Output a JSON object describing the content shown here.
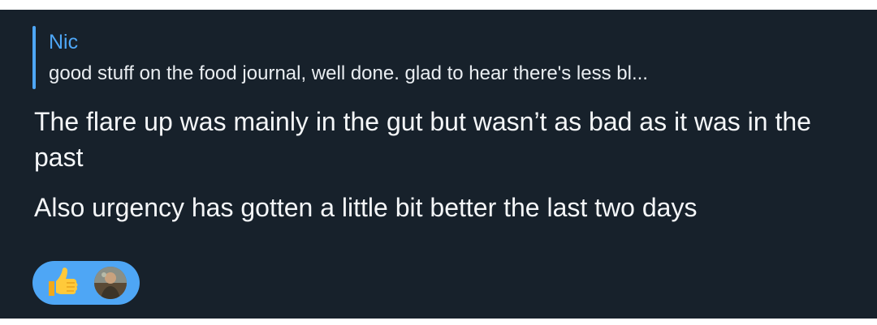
{
  "reply": {
    "author": "Nic",
    "snippet": "good stuff on the food journal, well done.   glad to hear there's less bl..."
  },
  "message": {
    "paragraphs": [
      "The flare up was mainly in the gut but wasn’t as bad as it was in the past",
      "Also urgency has gotten a little bit better the last two days"
    ]
  },
  "reaction": {
    "emoji_icon": "thumbs-up-icon",
    "accent_color": "#4ea6f5",
    "bubble_color": "#17212b"
  }
}
